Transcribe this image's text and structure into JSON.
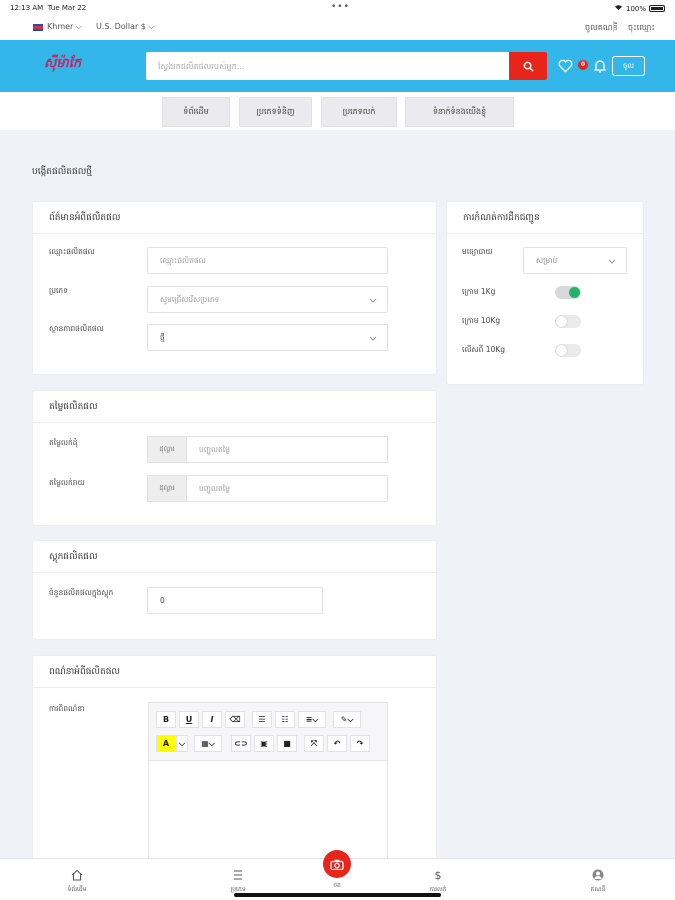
{
  "status": {
    "time": "12:13 AM",
    "date": "Tue Mar 22",
    "battery": "100%"
  },
  "util": {
    "language": "Khmer",
    "currency": "U.S. Dollar $",
    "login": "ចូលគណនី",
    "signup": "ចុះឈ្មោះ"
  },
  "header": {
    "logo": "ស៊ីម៉ាកែ",
    "search_placeholder": "ស្វែងរកផលិតផលរបស់អ្នក...",
    "badge": "0",
    "login_btn": "ចូល"
  },
  "nav": [
    "ទំព័រដើម",
    "ប្រភេទទំនិញ",
    "ប្រភេទលក់",
    "ទំនាក់ទំនងយើងខ្ញុំ"
  ],
  "page_title": "បង្កើតផលិតផលថ្មី",
  "product_info": {
    "title": "ព័ត៌មានអំពីផលិតផល",
    "fields": [
      {
        "label": "ឈ្មោះផលិតផល",
        "placeholder": "ឈ្មោះផលិតផល"
      },
      {
        "label": "ប្រភេទ",
        "placeholder": "សូមជ្រើសរើសប្រភេទ"
      },
      {
        "label": "ស្ថានភាពផលិតផល",
        "value": "ថ្មី"
      }
    ]
  },
  "pricing": {
    "title": "តម្លៃផលិតផល",
    "rows": [
      {
        "label": "តម្លៃលក់ដុំ",
        "addon": "ដុល្លារ",
        "placeholder": "បញ្ចូលតម្លៃ"
      },
      {
        "label": "តម្លៃលក់រាយ",
        "addon": "ដុល្លារ",
        "placeholder": "បញ្ចូលតម្លៃ"
      }
    ]
  },
  "stock": {
    "title": "ស្តុកផលិតផល",
    "label": "ចំនួនផលិតផលក្នុងស្តុក",
    "value": "0"
  },
  "description": {
    "title": "ពណ៌នាអំពីផលិតផល",
    "label": "ការពិពណ៌នា"
  },
  "shipping": {
    "title": "ការកំណត់ការដឹកជញ្ជូន",
    "method_label": "មធ្យោបាយ",
    "method_value": "សម្រាប់",
    "options": [
      {
        "label": "ក្រោម 1Kg",
        "on": true
      },
      {
        "label": "ក្រោម 10Kg",
        "on": false
      },
      {
        "label": "លើសពី 10Kg",
        "on": false
      }
    ]
  },
  "tabs": [
    "ទំព័រដើម",
    "ប្រភេទ",
    "ថត",
    "ការលក់",
    "គណនី"
  ],
  "colors": {
    "brand_blue": "#33b7ea",
    "accent_red": "#e8251b",
    "toggle_green": "#22b36a"
  }
}
